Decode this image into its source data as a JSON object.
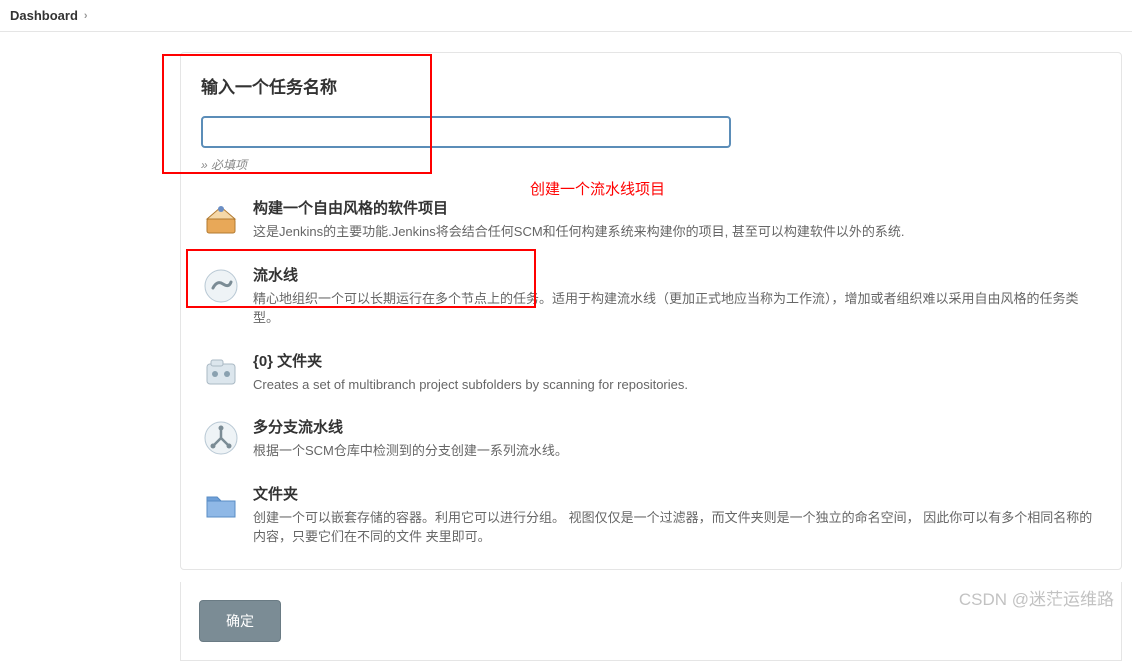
{
  "breadcrumb": {
    "label": "Dashboard"
  },
  "header": {
    "title": "输入一个任务名称",
    "required_note": "» 必填项"
  },
  "name_input": {
    "value": "",
    "placeholder": ""
  },
  "annotation": {
    "create_pipeline": "创建一个流水线项目"
  },
  "items": [
    {
      "title": "构建一个自由风格的软件项目",
      "desc": "这是Jenkins的主要功能.Jenkins将会结合任何SCM和任何构建系统来构建你的项目, 甚至可以构建软件以外的系统."
    },
    {
      "title": "流水线",
      "desc": "精心地组织一个可以长期运行在多个节点上的任务。适用于构建流水线（更加正式地应当称为工作流），增加或者组织难以采用自由风格的任务类型。"
    },
    {
      "title": "{0} 文件夹",
      "desc": "Creates a set of multibranch project subfolders by scanning for repositories."
    },
    {
      "title": "多分支流水线",
      "desc": "根据一个SCM仓库中检测到的分支创建一系列流水线。"
    },
    {
      "title": "文件夹",
      "desc": "创建一个可以嵌套存储的容器。利用它可以进行分组。 视图仅仅是一个过滤器，而文件夹则是一个独立的命名空间， 因此你可以有多个相同名称的内容，只要它们在不同的文件 夹里即可。"
    }
  ],
  "submit": {
    "label": "确定"
  },
  "watermark": "CSDN @迷茫运维路"
}
